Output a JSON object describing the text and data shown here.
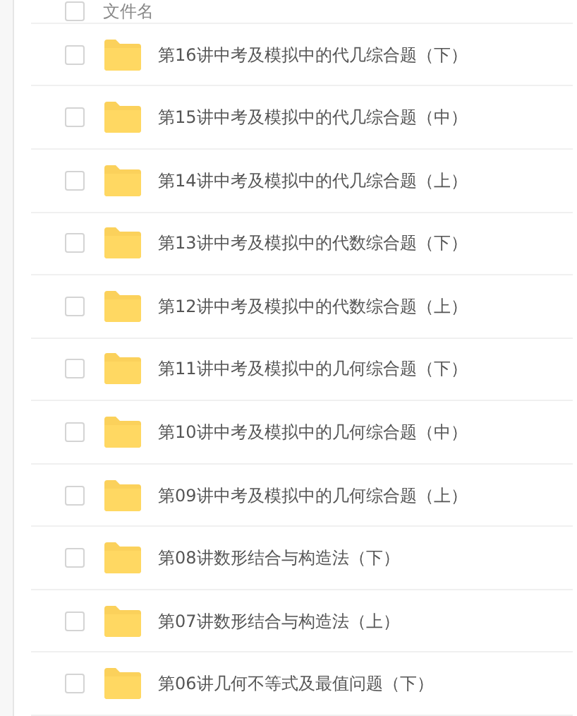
{
  "header": {
    "label": "文件名",
    "checked": false
  },
  "files": [
    {
      "name": "第16讲中考及模拟中的代几综合题（下）",
      "checked": false
    },
    {
      "name": "第15讲中考及模拟中的代几综合题（中）",
      "checked": false
    },
    {
      "name": "第14讲中考及模拟中的代几综合题（上）",
      "checked": false
    },
    {
      "name": "第13讲中考及模拟中的代数综合题（下）",
      "checked": false
    },
    {
      "name": "第12讲中考及模拟中的代数综合题（上）",
      "checked": false
    },
    {
      "name": "第11讲中考及模拟中的几何综合题（下）",
      "checked": false
    },
    {
      "name": "第10讲中考及模拟中的几何综合题（中）",
      "checked": false
    },
    {
      "name": "第09讲中考及模拟中的几何综合题（上）",
      "checked": false
    },
    {
      "name": "第08讲数形结合与构造法（下）",
      "checked": false
    },
    {
      "name": "第07讲数形结合与构造法（上）",
      "checked": false
    },
    {
      "name": "第06讲几何不等式及最值问题（下）",
      "checked": false
    }
  ]
}
